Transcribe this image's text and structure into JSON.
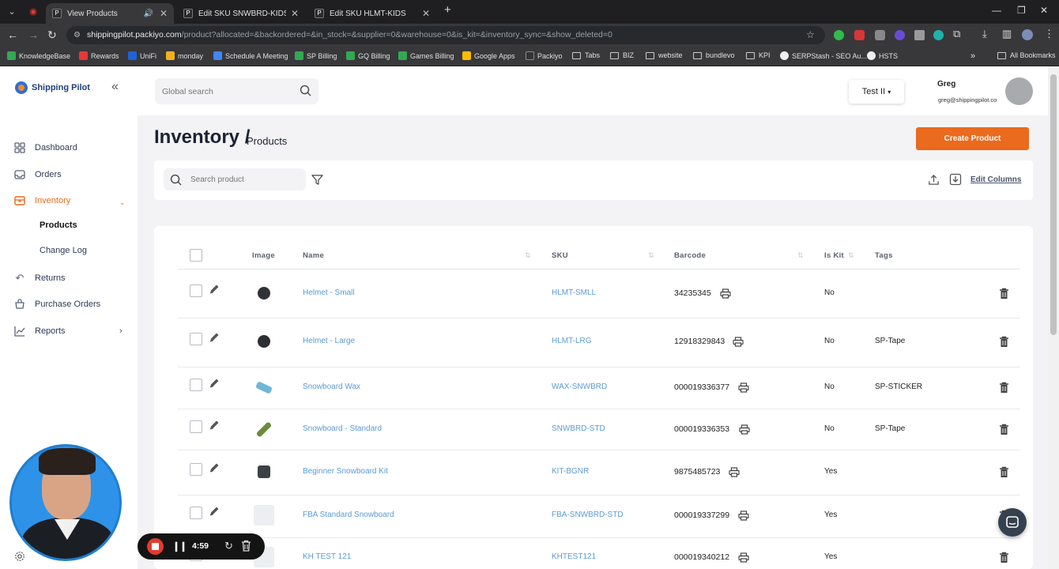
{
  "browser": {
    "tabs": [
      {
        "title": "View Products",
        "active": true
      },
      {
        "title": "Edit SKU SNWBRD-KIDS",
        "active": false
      },
      {
        "title": "Edit SKU HLMT-KIDS",
        "active": false
      }
    ],
    "url_host": "shippingpilot.packiyo.com",
    "url_path": "/product?allocated=&backordered=&in_stock=&supplier=0&warehouse=0&is_kit=&inventory_sync=&show_deleted=0",
    "bookmarks": [
      "KnowledgeBase",
      "Rewards",
      "UniFi",
      "monday",
      "Schedule A Meeting",
      "SP Billing",
      "GQ Billing",
      "Games Billing",
      "Google Apps",
      "Packiyo",
      "Tabs",
      "BIZ",
      "website",
      "bundlevo",
      "KPI",
      "SERPStash - SEO Au...",
      "HSTS"
    ],
    "all_bookmarks": "All Bookmarks"
  },
  "app": {
    "logo": "Shipping Pilot",
    "nav": [
      {
        "label": "Dashboard",
        "icon": "grid-icon"
      },
      {
        "label": "Orders",
        "icon": "inbox-icon"
      },
      {
        "label": "Inventory",
        "icon": "box-icon"
      },
      {
        "label": "Returns",
        "icon": "undo-icon"
      },
      {
        "label": "Purchase Orders",
        "icon": "cart-icon"
      },
      {
        "label": "Reports",
        "icon": "chart-line-icon"
      }
    ],
    "subnav": [
      "Products",
      "Change Log"
    ],
    "search_placeholder": "Global search",
    "tenant": "Test II",
    "user_name": "Greg",
    "user_email": "greg@shippingpilot.co"
  },
  "page": {
    "title": "Inventory /",
    "subtitle": "Products",
    "create_button": "Create Product",
    "product_search_placeholder": "Search product",
    "edit_columns": "Edit Columns"
  },
  "table": {
    "columns": [
      "Image",
      "Name",
      "SKU",
      "Barcode",
      "Is Kit",
      "Tags"
    ],
    "rows": [
      {
        "name": "Helmet - Small",
        "sku": "HLMT-SMLL",
        "barcode": "34235345",
        "is_kit": "No",
        "tags": ""
      },
      {
        "name": "Helmet - Large",
        "sku": "HLMT-LRG",
        "barcode": "12918329843",
        "is_kit": "No",
        "tags": "SP-Tape"
      },
      {
        "name": "Snowboard Wax",
        "sku": "WAX-SNWBRD",
        "barcode": "000019336377",
        "is_kit": "No",
        "tags": "SP-STICKER"
      },
      {
        "name": "Snowboard - Standard",
        "sku": "SNWBRD-STD",
        "barcode": "000019336353",
        "is_kit": "No",
        "tags": "SP-Tape"
      },
      {
        "name": "Beginner Snowboard Kit",
        "sku": "KIT-BGNR",
        "barcode": "9875485723",
        "is_kit": "Yes",
        "tags": ""
      },
      {
        "name": "FBA Standard Snowboard",
        "sku": "FBA-SNWBRD-STD",
        "barcode": "000019337299",
        "is_kit": "Yes",
        "tags": ""
      },
      {
        "name": "KH TEST 121",
        "sku": "KHTEST121",
        "barcode": "000019340212",
        "is_kit": "Yes",
        "tags": ""
      }
    ]
  },
  "recorder": {
    "time": "4:59"
  },
  "colors": {
    "accent": "#ea6a1e",
    "link": "#5b9bd5",
    "brand_blue": "#2e6fd8"
  }
}
